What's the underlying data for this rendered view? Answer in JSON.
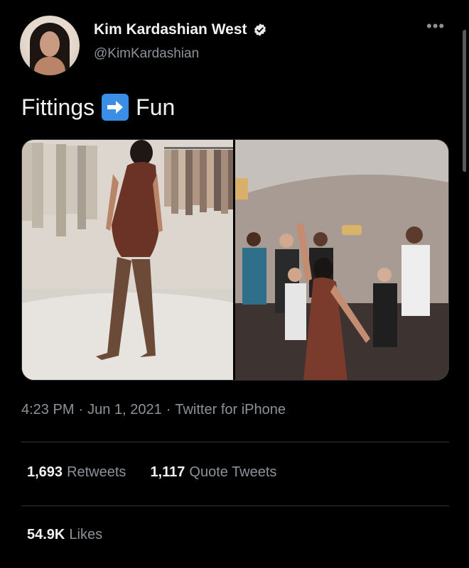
{
  "author": {
    "display_name": "Kim Kardashian West",
    "handle": "@KimKardashian",
    "verified": true
  },
  "tweet": {
    "text_before": "Fittings",
    "emoji": "right-arrow",
    "text_after": "Fun"
  },
  "meta": {
    "time": "4:23 PM",
    "sep1": "·",
    "date": "Jun 1, 2021",
    "sep2": "·",
    "source": "Twitter for iPhone"
  },
  "stats": {
    "retweets_value": "1,693",
    "retweets_label": "Retweets",
    "quotes_value": "1,117",
    "quotes_label": "Quote Tweets",
    "likes_value": "54.9K",
    "likes_label": "Likes"
  },
  "colors": {
    "background": "#000000",
    "text": "#e7e9ea",
    "muted": "#8b9298",
    "verified": "#e7e9ea",
    "arrow_box": "#3a8ee6"
  },
  "icons": {
    "verified": "verified-badge-icon",
    "more": "more-horizontal-icon",
    "arrow": "right-arrow-emoji-icon"
  }
}
